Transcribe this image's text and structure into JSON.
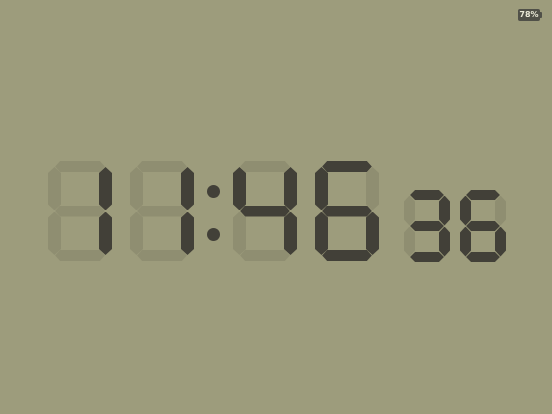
{
  "clock": {
    "hours": "11",
    "minutes": "46",
    "seconds": "36",
    "separator": ":",
    "time_text": "11:46"
  },
  "status": {
    "battery_label": "78%",
    "battery_level": 0.78
  },
  "colors": {
    "background": "#9d9c7c",
    "segment_on": "#424038",
    "segment_off": "#8f8e71"
  }
}
